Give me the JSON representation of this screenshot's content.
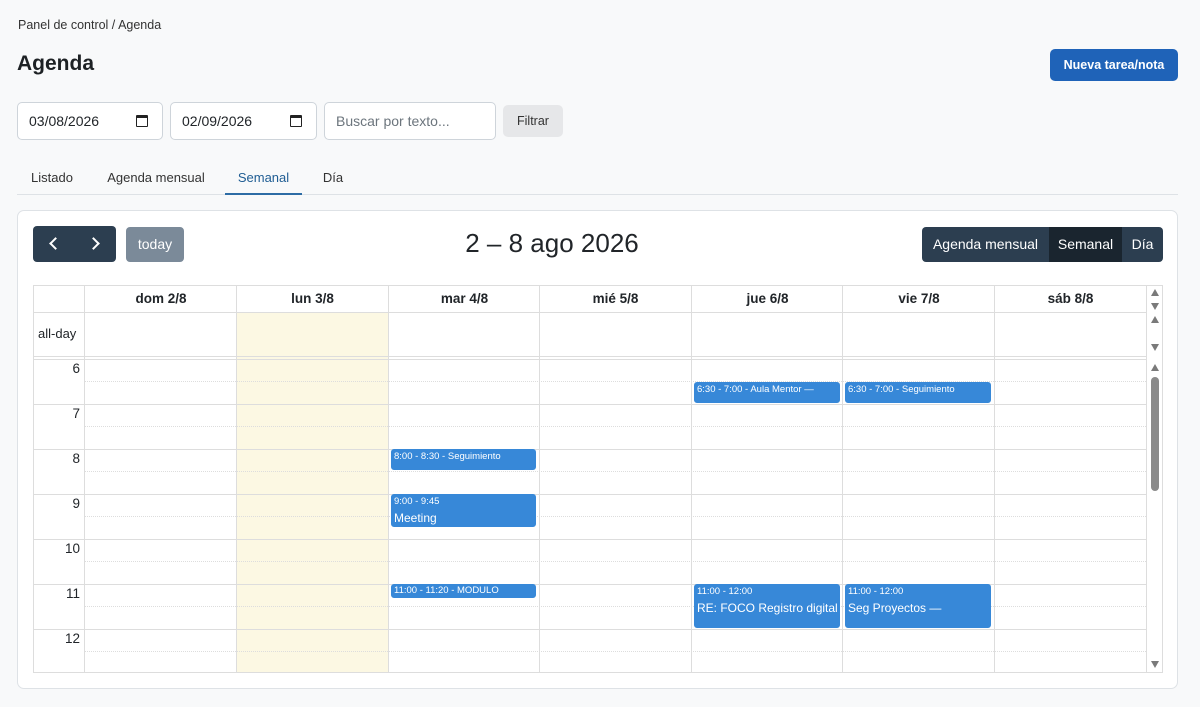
{
  "breadcrumb": "Panel de control / Agenda",
  "page_title": "Agenda",
  "new_task_label": "Nueva tarea/nota",
  "filters": {
    "date_from": "03/08/2026",
    "date_to": "02/09/2026",
    "search_placeholder": "Buscar por texto...",
    "filter_label": "Filtrar"
  },
  "tabs": [
    {
      "label": "Listado"
    },
    {
      "label": "Agenda mensual"
    },
    {
      "label": "Semanal",
      "active": true
    },
    {
      "label": "Día"
    }
  ],
  "calendar": {
    "title": "2 – 8 ago 2026",
    "today_label": "today",
    "prev_icon": "chevron-left-icon",
    "next_icon": "chevron-right-icon",
    "views": [
      {
        "label": "Agenda mensual"
      },
      {
        "label": "Semanal",
        "active": true
      },
      {
        "label": "Día"
      }
    ],
    "allday_label": "all-day",
    "days": [
      "dom 2/8",
      "lun 3/8",
      "mar 4/8",
      "mié 5/8",
      "jue 6/8",
      "vie 7/8",
      "sáb 8/8"
    ],
    "hours": [
      "6",
      "7",
      "8",
      "9",
      "10",
      "11",
      "12"
    ],
    "events": [
      {
        "time": "6:30 - 7:00 - Aula Mentor —",
        "title": ""
      },
      {
        "time": "6:30 - 7:00 - Seguimiento",
        "title": ""
      },
      {
        "time": "8:00 - 8:30 - Seguimiento",
        "title": ""
      },
      {
        "time": "9:00 - 9:45",
        "title": "Meeting"
      },
      {
        "time": "11:00 - 11:20 - MODULO",
        "title": ""
      },
      {
        "time": "11:00 - 12:00",
        "title": "RE: FOCO Registro digital"
      },
      {
        "time": "11:00 - 12:00",
        "title": "Seg Proyectos —"
      }
    ],
    "colors": {
      "event": "#3788d8",
      "today_bg": "#fcf8e3",
      "toolbar_dark": "#2c3e50",
      "primary": "#1f63b8"
    }
  }
}
